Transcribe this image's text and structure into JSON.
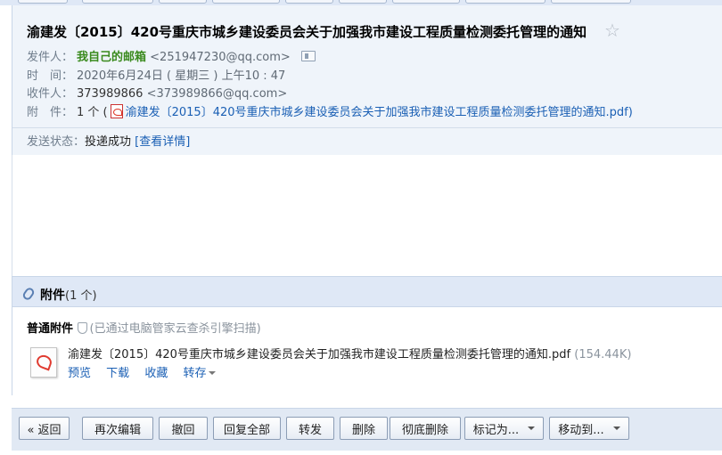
{
  "email": {
    "subject": "渝建发〔2015〕420号重庆市城乡建设委员会关于加强我市建设工程质量检测委托管理的通知",
    "star_icon": "star-outline-icon",
    "from_label": "发件人：",
    "from_name": "我自己的邮箱",
    "from_address": "<251947230@qq.com>",
    "time_label": "时　间：",
    "time_value": "2020年6月24日 ( 星期三 ) 上午10 : 47",
    "to_label": "收件人：",
    "to_name": "373989866",
    "to_address": "<373989866@qq.com>",
    "attach_label": "附　件：",
    "attach_count": "1 个 (",
    "attach_file": "渝建发〔2015〕420号重庆市城乡建设委员会关于加强我市建设工程质量检测委托管理的通知.pdf",
    "attach_close": ")",
    "status_label": "发送状态：",
    "status_value": "投递成功",
    "status_link": "[查看详情]"
  },
  "attachments": {
    "title": "附件",
    "count": "(1 个)",
    "kind": "普通附件",
    "scan_note": "(已通过电脑管家云查杀引擎扫描)",
    "file_name": "渝建发〔2015〕420号重庆市城乡建设委员会关于加强我市建设工程质量检测委托管理的通知.pdf",
    "file_size": "(154.44K)",
    "actions": {
      "preview": "预览",
      "download": "下载",
      "favorite": "收藏",
      "forward": "转存"
    }
  },
  "toolbar": {
    "back": "« 返回",
    "edit_again": "再次编辑",
    "recall": "撤回",
    "reply_all": "回复全部",
    "forward": "转发",
    "delete": "删除",
    "delete_permanent": "彻底删除",
    "mark_as": "标记为...",
    "move_to": "移动到..."
  },
  "colors": {
    "header_bg": "#eff4fa",
    "bar_bg": "#dfe8f6",
    "link": "#1a5fb4",
    "sender": "#3a8a1e"
  }
}
